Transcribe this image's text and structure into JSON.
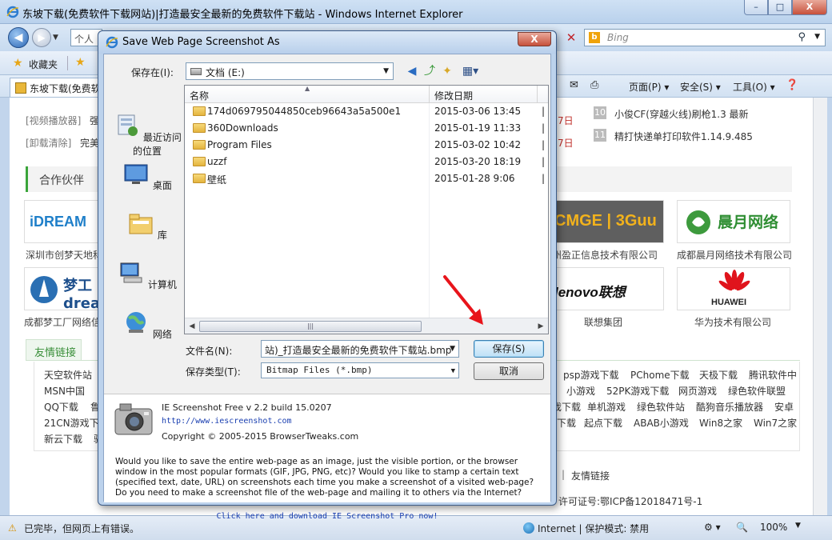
{
  "browser": {
    "title": "东坡下载(免费软件下载网站)|打造最安全最新的免费软件下载站 - Windows Internet Explorer",
    "window_buttons": [
      "–",
      "□",
      "X"
    ],
    "address_partial": "个人",
    "search_placeholder": "Bing",
    "favorites_label": "收藏夹",
    "tab_label": "东坡下载(免费软",
    "commands": [
      "页面(P) ▾",
      "安全(S) ▾",
      "工具(O) ▾"
    ],
    "status_text": "已完毕，但网页上有错误。",
    "status_zone": "Internet | 保护模式: 禁用",
    "zoom": "100%"
  },
  "page": {
    "left_links": [
      {
        "tag": "[视频播放器]",
        "text": "强"
      },
      {
        "tag": "[卸载清除]",
        "text": "完美"
      }
    ],
    "date_fragments": [
      "7日",
      "7日"
    ],
    "news": [
      {
        "num": "10",
        "text": "小俊CF(穿越火线)刷枪1.3 最新"
      },
      {
        "num": "11",
        "text": "精打快递单打印软件1.14.9.485"
      }
    ],
    "partners_heading": "合作伙伴",
    "partners": [
      {
        "logo": "iDREAM",
        "caption": "深圳市创梦天地科"
      },
      {
        "logo": "CMGE | 3Guu",
        "caption": "州盈正信息技术有限公司"
      },
      {
        "logo": "晨月网络",
        "caption": "成都晨月网络技术有限公司"
      },
      {
        "logo": "梦工 dream",
        "caption": "成都梦工厂网络信"
      },
      {
        "logo": "lenovo联想",
        "caption": "联想集团"
      },
      {
        "logo": "HUAWEI",
        "caption": "华为技术有限公司"
      }
    ],
    "friend_links_tab": "友情链接",
    "friend_links_left": [
      "天空软件站",
      "MSN中国",
      "QQ下载",
      "21CN游戏下",
      "新云下载"
    ],
    "friend_links_left2": [
      "鲁",
      "驱"
    ],
    "friend_links_right": [
      [
        "psp游戏下载",
        "PChome下载",
        "天极下载",
        "腾讯软件中"
      ],
      [
        "小游戏",
        "52PK游戏下载",
        "网页游戏",
        "绿色软件联盟"
      ],
      [
        "戏下载",
        "单机游戏",
        "绿色软件站",
        "酷狗音乐播放器",
        "安卓"
      ],
      [
        "下载",
        "起点下载",
        "ABAB小游戏",
        "Win8之家",
        "Win7之家"
      ]
    ],
    "footer_link": "友情链接",
    "footer_icp": "许可证号:鄂ICP备12018471号-1"
  },
  "dialog": {
    "title": "Save Web Page Screenshot As",
    "close": "X",
    "look_in_label": "保存在(I):",
    "look_in_value": "文档 (E:)",
    "places": [
      "最近访问的位置",
      "桌面",
      "库",
      "计算机",
      "网络"
    ],
    "columns": {
      "name": "名称",
      "date": "修改日期"
    },
    "files": [
      {
        "name": "174d069795044850ceb96643a5a500e1",
        "date": "2015-03-06 13:45"
      },
      {
        "name": "360Downloads",
        "date": "2015-01-19 11:33"
      },
      {
        "name": "Program Files",
        "date": "2015-03-02 10:42"
      },
      {
        "name": "uzzf",
        "date": "2015-03-20 18:19"
      },
      {
        "name": "壁纸",
        "date": "2015-01-28 9:06"
      }
    ],
    "filename_label": "文件名(N):",
    "filename_value": "站)_打造最安全最新的免费软件下载站.bmp",
    "filetype_label": "保存类型(T):",
    "filetype_value": "Bitmap Files (*.bmp)",
    "save_button": "保存(S)",
    "cancel_button": "取消",
    "product": "IE Screenshot Free v 2.2 build 15.0207",
    "url": "http://www.iescreenshot.com",
    "copyright": "Copyright © 2005-2015 BrowserTweaks.com",
    "description": "Would you like to save the entire web-page as an image, just the  visible  portion, or the browser window in the most popular formats  (GIF, JPG, PNG, etc)?  Would you like to stamp a certain text  (specified text, date, URL)  on screenshots  each time you make  a  screenshot of  a  visited web-page?  Do  you  need  to make  a screenshot file of the web-page and mailing it to others via the Internet?",
    "promo_link": "Click here and download IE Screenshot Pro now!"
  },
  "colors": {
    "annotation_arrow": "#e8141b",
    "accent_green": "#3aa53a",
    "date_red": "#c0302b"
  }
}
